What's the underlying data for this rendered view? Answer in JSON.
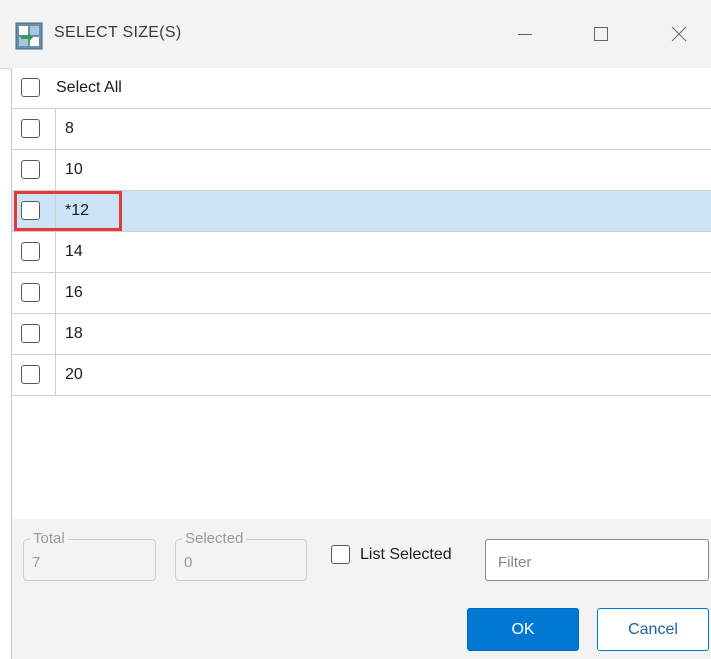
{
  "window": {
    "title": "SELECT SIZE(S)",
    "icons": {
      "app": "app-icon",
      "minimize": "minimize-icon",
      "maximize": "maximize-icon",
      "close": "close-icon"
    }
  },
  "list": {
    "select_all_label": "Select All",
    "items": [
      {
        "label": "8",
        "checked": false,
        "selected": false
      },
      {
        "label": "10",
        "checked": false,
        "selected": false
      },
      {
        "label": "*12",
        "checked": false,
        "selected": true
      },
      {
        "label": "14",
        "checked": false,
        "selected": false
      },
      {
        "label": "16",
        "checked": false,
        "selected": false
      },
      {
        "label": "18",
        "checked": false,
        "selected": false
      },
      {
        "label": "20",
        "checked": false,
        "selected": false
      }
    ]
  },
  "footer": {
    "total_label": "Total",
    "total_value": "7",
    "selected_label": "Selected",
    "selected_value": "0",
    "list_selected_label": "List Selected",
    "filter_placeholder": "Filter",
    "filter_value": "",
    "ok_label": "OK",
    "cancel_label": "Cancel"
  },
  "colors": {
    "accent": "#0078d4",
    "selected_row": "#cce4f7",
    "highlight_box": "#e53935"
  }
}
